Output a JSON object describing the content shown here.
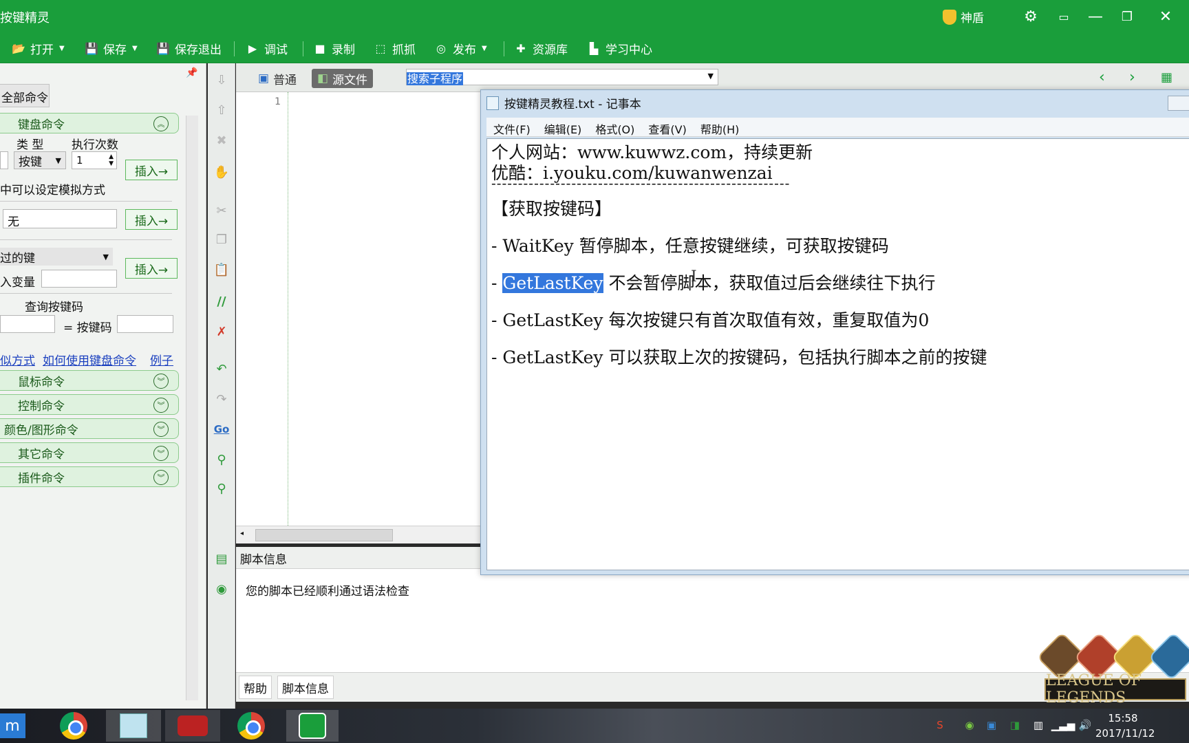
{
  "app": {
    "title": "按键精灵",
    "shield_label": "神盾"
  },
  "toolbar": {
    "open": "打开",
    "save": "保存",
    "save_exit": "保存退出",
    "debug": "调试",
    "record": "录制",
    "grab": "抓抓",
    "publish": "发布",
    "resources": "资源库",
    "learning": "学习中心"
  },
  "left_panel": {
    "all_commands_tab": "全部命令",
    "keyboard_category": "键盘命令",
    "type_label": "类 型",
    "exec_count_label": "执行次数",
    "type_value": "按键",
    "exec_count_value": "1",
    "insert_label": "插入→",
    "sim_hint": "中可以设定模拟方式",
    "key_value": "无",
    "key_select": "过的键",
    "var_label": "入变量",
    "query_label": "查询按键码",
    "keycode_label": "= 按键码",
    "links": [
      "似方式",
      "如何使用键盘命令",
      "例子"
    ],
    "categories": [
      "鼠标命令",
      "控制命令",
      "颜色/图形命令",
      "其它命令",
      "插件命令"
    ]
  },
  "editor": {
    "tab_normal": "普通",
    "tab_source": "源文件",
    "search_placeholder": "搜索子程序",
    "line_number": "1",
    "info_header": "脚本信息",
    "info_text": "您的脚本已经顺利通过语法检查",
    "bottom_tabs": [
      "帮助",
      "脚本信息"
    ]
  },
  "notepad": {
    "title": "按键精灵教程.txt - 记事本",
    "menu": [
      "文件(F)",
      "编辑(E)",
      "格式(O)",
      "查看(V)",
      "帮助(H)"
    ],
    "lines": {
      "site": "个人网站：www.kuwwz.com，持续更新",
      "youku": "优酷：i.youku.com/kuwanwenzai",
      "divider": "--------------------------------------------------------",
      "heading": "【获取按键码】",
      "l1": "- WaitKey 暂停脚本，任意按键继续，可获取按键码",
      "l2_prefix": "- ",
      "l2_highlight": "GetLastKey",
      "l2_rest": " 不会暂停脚本，获取值过后会继续往下执行",
      "l3": "- GetLastKey 每次按键只有首次取值有效，重复取值为0",
      "l4": "- GetLastKey 可以获取上次的按键码，包括执行脚本之前的按键"
    }
  },
  "overlay": {
    "lol_logo": "LEAGUE OF LEGENDS"
  },
  "taskbar": {
    "time": "15:58",
    "date": "2017/11/12"
  },
  "colors": {
    "brand_green": "#1a9e3b",
    "selection_blue": "#3377dd"
  }
}
